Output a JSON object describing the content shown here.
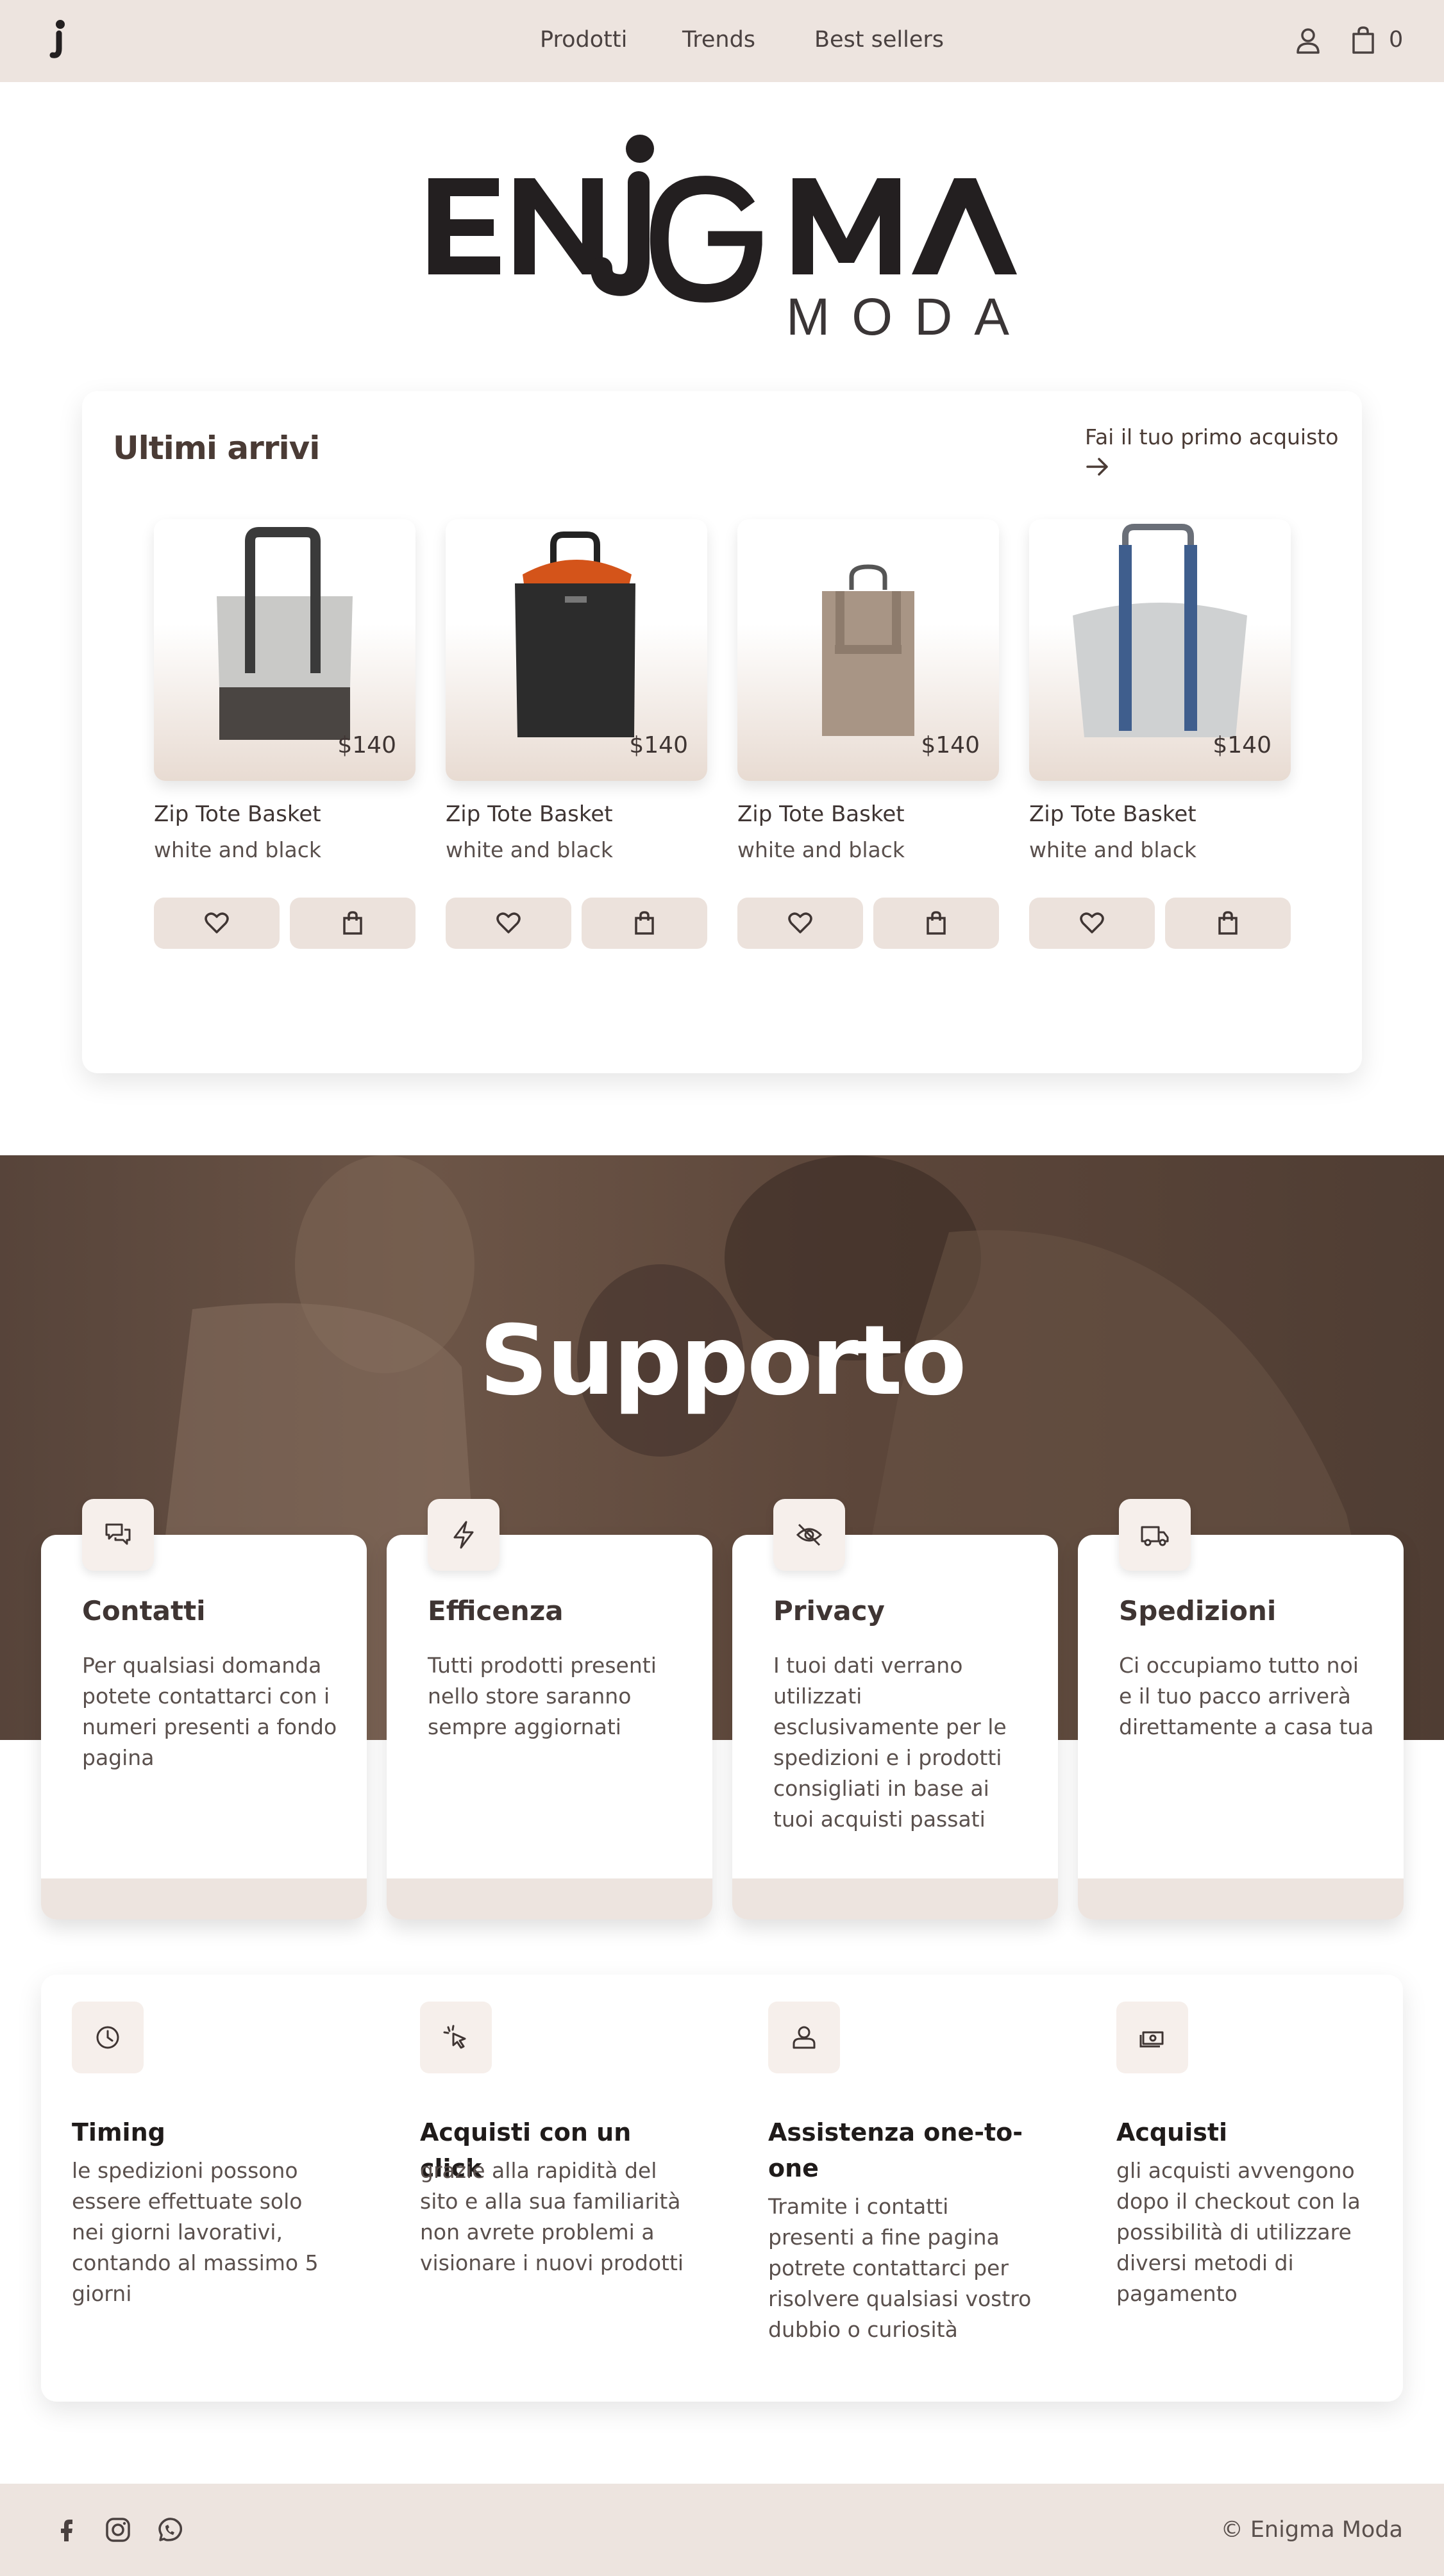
{
  "colors": {
    "header_bg": "#ede4df",
    "accent_brown": "#4a3b35",
    "hero_brown": "#5c463a",
    "button_bg": "#ece2dc"
  },
  "header": {
    "nav": [
      "Prodotti",
      "Trends",
      "Best sellers"
    ],
    "cart_count": "0",
    "icons": [
      "brand-mark-icon",
      "user-icon",
      "shopping-bag-icon"
    ]
  },
  "logo": {
    "word": "ENIGMA",
    "sub": "MODA"
  },
  "arrivals": {
    "title": "Ultimi arrivi",
    "cta": "Fai il tuo primo acquisto",
    "products": [
      {
        "name": "Zip Tote Basket",
        "color": "white and black",
        "price": "$140",
        "image": "grey-black-tote"
      },
      {
        "name": "Zip Tote Basket",
        "color": "white and black",
        "price": "$140",
        "image": "black-orange-tote"
      },
      {
        "name": "Zip Tote Basket",
        "color": "white and black",
        "price": "$140",
        "image": "taupe-backpack"
      },
      {
        "name": "Zip Tote Basket",
        "color": "white and black",
        "price": "$140",
        "image": "grey-blue-tote"
      }
    ]
  },
  "support": {
    "title": "Supporto",
    "features": [
      {
        "title": "Contatti",
        "text": "Per qualsiasi domanda potete contattarci con i numeri presenti a fondo pagina",
        "icon": "chat-icon"
      },
      {
        "title": "Efficenza",
        "text": "Tutti prodotti presenti nello store saranno sempre aggiornati",
        "icon": "lightning-icon"
      },
      {
        "title": "Privacy",
        "text": "I tuoi dati verrano utilizzati esclusivamente per le spedizioni e i prodotti consigliati in base ai tuoi acquisti passati",
        "icon": "eye-off-icon"
      },
      {
        "title": "Spedizioni",
        "text": "Ci occupiamo tutto noi e il tuo pacco arriverà direttamente a casa tua",
        "icon": "truck-icon"
      }
    ]
  },
  "info": [
    {
      "title": "Timing",
      "text": "le spedizioni possono essere effettuate solo nei giorni lavorativi, contando al massimo 5 giorni",
      "icon": "clock-icon"
    },
    {
      "title": "Acquisti con un click",
      "text": "grazie alla rapidità del sito e alla sua familiarità non avrete problemi a visionare i nuovi prodotti",
      "icon": "cursor-click-icon"
    },
    {
      "title": "Assistenza one-to-one",
      "text": "Tramite i contatti presenti a fine pagina potrete contattarci per risolvere qualsiasi vostro dubbio o curiosità",
      "icon": "users-icon"
    },
    {
      "title": "Acquisti",
      "text": "gli acquisti avvengono dopo il checkout con la possibilità di utilizzare diversi metodi di pagamento",
      "icon": "cash-icon"
    }
  ],
  "footer": {
    "copyright": "© Enigma Moda",
    "social": [
      "facebook-icon",
      "instagram-icon",
      "whatsapp-icon"
    ]
  }
}
